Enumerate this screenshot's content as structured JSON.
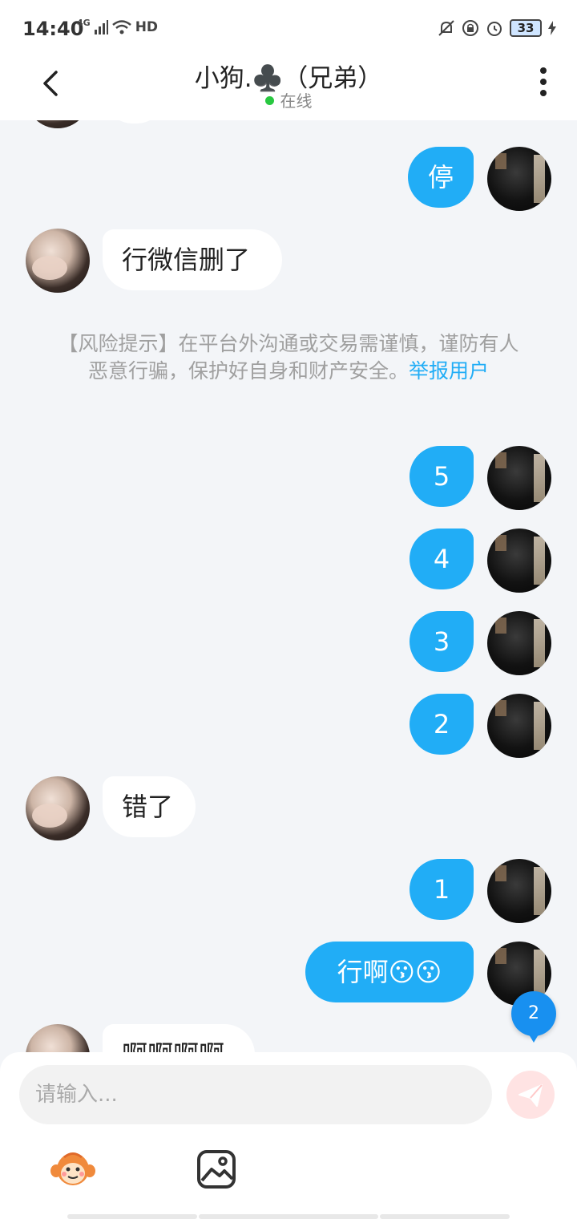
{
  "status_bar": {
    "time": "14:40",
    "network": "4G",
    "hd": "HD",
    "battery": "33"
  },
  "header": {
    "title": "小狗.♣️（兄弟）",
    "status": "在线"
  },
  "messages": [
    {
      "side": "self",
      "text": "停"
    },
    {
      "side": "other",
      "text": "行微信删了"
    },
    {
      "side": "self",
      "text": "5"
    },
    {
      "side": "self",
      "text": "4"
    },
    {
      "side": "self",
      "text": "3"
    },
    {
      "side": "self",
      "text": "2"
    },
    {
      "side": "other",
      "text": "错了"
    },
    {
      "side": "self",
      "text": "1"
    },
    {
      "side": "self",
      "text": "行啊😗😗"
    },
    {
      "side": "other",
      "text": "啊啊啊啊"
    }
  ],
  "notice": {
    "text": "【风险提示】在平台外沟通或交易需谨慎，谨防有人恶意行骗，保护好自身和财产安全。",
    "link": "举报用户"
  },
  "unread_count": "2",
  "input": {
    "placeholder": "请输入..."
  },
  "icons": {
    "back": "chevron-left-icon",
    "more": "more-vertical-icon",
    "send": "paper-plane-icon",
    "emoji": "monkey-emoji-icon",
    "image": "image-icon"
  },
  "colors": {
    "self_bubble": "#21adf6",
    "background": "#f3f5f8",
    "online_dot": "#28c840",
    "unread_badge": "#1890f0"
  }
}
